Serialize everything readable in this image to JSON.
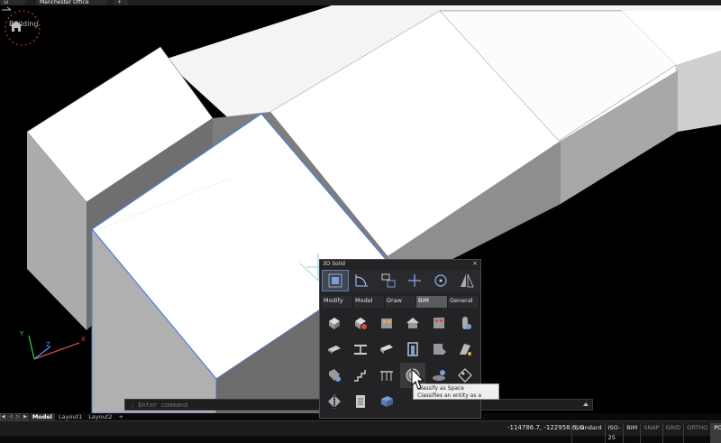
{
  "tabs": [
    {
      "label": "ui"
    },
    {
      "label": "Manchester Office"
    }
  ],
  "tab_new_label": "+",
  "breadcrumb": {
    "label": "Building"
  },
  "ucs": {
    "x": "X",
    "y": "Y",
    "z": "Z"
  },
  "command": {
    "placeholder": ": Enter command"
  },
  "layouts": {
    "nav": [
      "◀",
      "◁",
      "▷",
      "▶"
    ],
    "tabs": [
      "Model",
      "Layout1",
      "Layout2"
    ],
    "add": "+"
  },
  "status": {
    "coords": "-114786.7, -122958.6, 0",
    "items": [
      {
        "label": "Standard",
        "state": "on"
      },
      {
        "label": "ISO-25",
        "state": "on"
      },
      {
        "label": "BIM",
        "state": "on"
      },
      {
        "label": "SNAP",
        "state": "off"
      },
      {
        "label": "GRID",
        "state": "off"
      },
      {
        "label": "ORTHO",
        "state": "off"
      },
      {
        "label": "POLAR",
        "state": "active"
      }
    ]
  },
  "panel": {
    "title": "3D Solid",
    "close": "×",
    "categories": [
      {
        "label": "Modify"
      },
      {
        "label": "Model"
      },
      {
        "label": "Draw"
      },
      {
        "label": "BIM"
      },
      {
        "label": "General"
      }
    ]
  },
  "tooltip": {
    "title": "Classify as Space",
    "description": "Classifies an entity as a space."
  },
  "colors": {
    "viewport": "#000000",
    "selection": "#4a7fd8",
    "accent": "#d24a4a"
  }
}
